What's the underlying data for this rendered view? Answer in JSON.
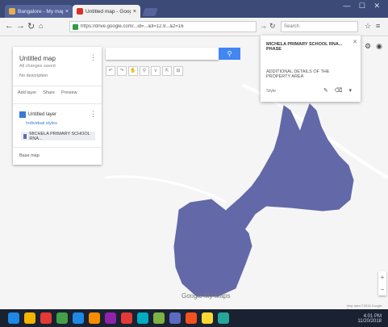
{
  "browser": {
    "tabs": [
      {
        "label": "Bangalore - My maps...",
        "favicon_color": "#e8b04a"
      },
      {
        "label": "Untitled map - Google My Maps",
        "favicon_color": "#d93025"
      }
    ],
    "window_controls": "— ☐ ✕",
    "url": "https://drive.google.com/...id=...&ll=12.9...&z=16",
    "search_placeholder": "Search"
  },
  "panel": {
    "title": "Untitled map",
    "subtitle": "All changes saved",
    "description": "No description",
    "actions": [
      "Add layer",
      "Share",
      "Preview"
    ],
    "layer_name": "Untitled layer",
    "layer_style": "Individual styles",
    "feature_name": "MICHELA PRIMARY SCHOOL RNA...",
    "basemap_label": "Base map"
  },
  "map_search": {
    "button_icon": "search-icon"
  },
  "tools": [
    "↶",
    "↷",
    "✋",
    "⚲",
    "⋎",
    "⇱",
    "⊟"
  ],
  "popup": {
    "title": "MICHELA PRIMARY SCHOOL RNA... PHASE",
    "description": "ADDITIONAL DETAILS OF THE PROPERTY AREA",
    "footer": "Style",
    "icons": "✎ ⌫ ▾"
  },
  "map": {
    "polygon_color": "#6268a8",
    "road_color": "#ffffff",
    "google_logo": "Google My Maps",
    "footer": "Map data ©2018 Google  Terms"
  },
  "taskbar": {
    "clock_time": "4:01 PM",
    "clock_date": "11/20/2018",
    "icon_colors": [
      "#1e88e5",
      "#f4b400",
      "#e53935",
      "#43a047",
      "#1e88e5",
      "#fb8c00",
      "#8e24aa",
      "#e53935",
      "#00acc1",
      "#7cb342",
      "#5c6bc0",
      "#f4511e",
      "#fdd835",
      "#26a69a"
    ]
  }
}
